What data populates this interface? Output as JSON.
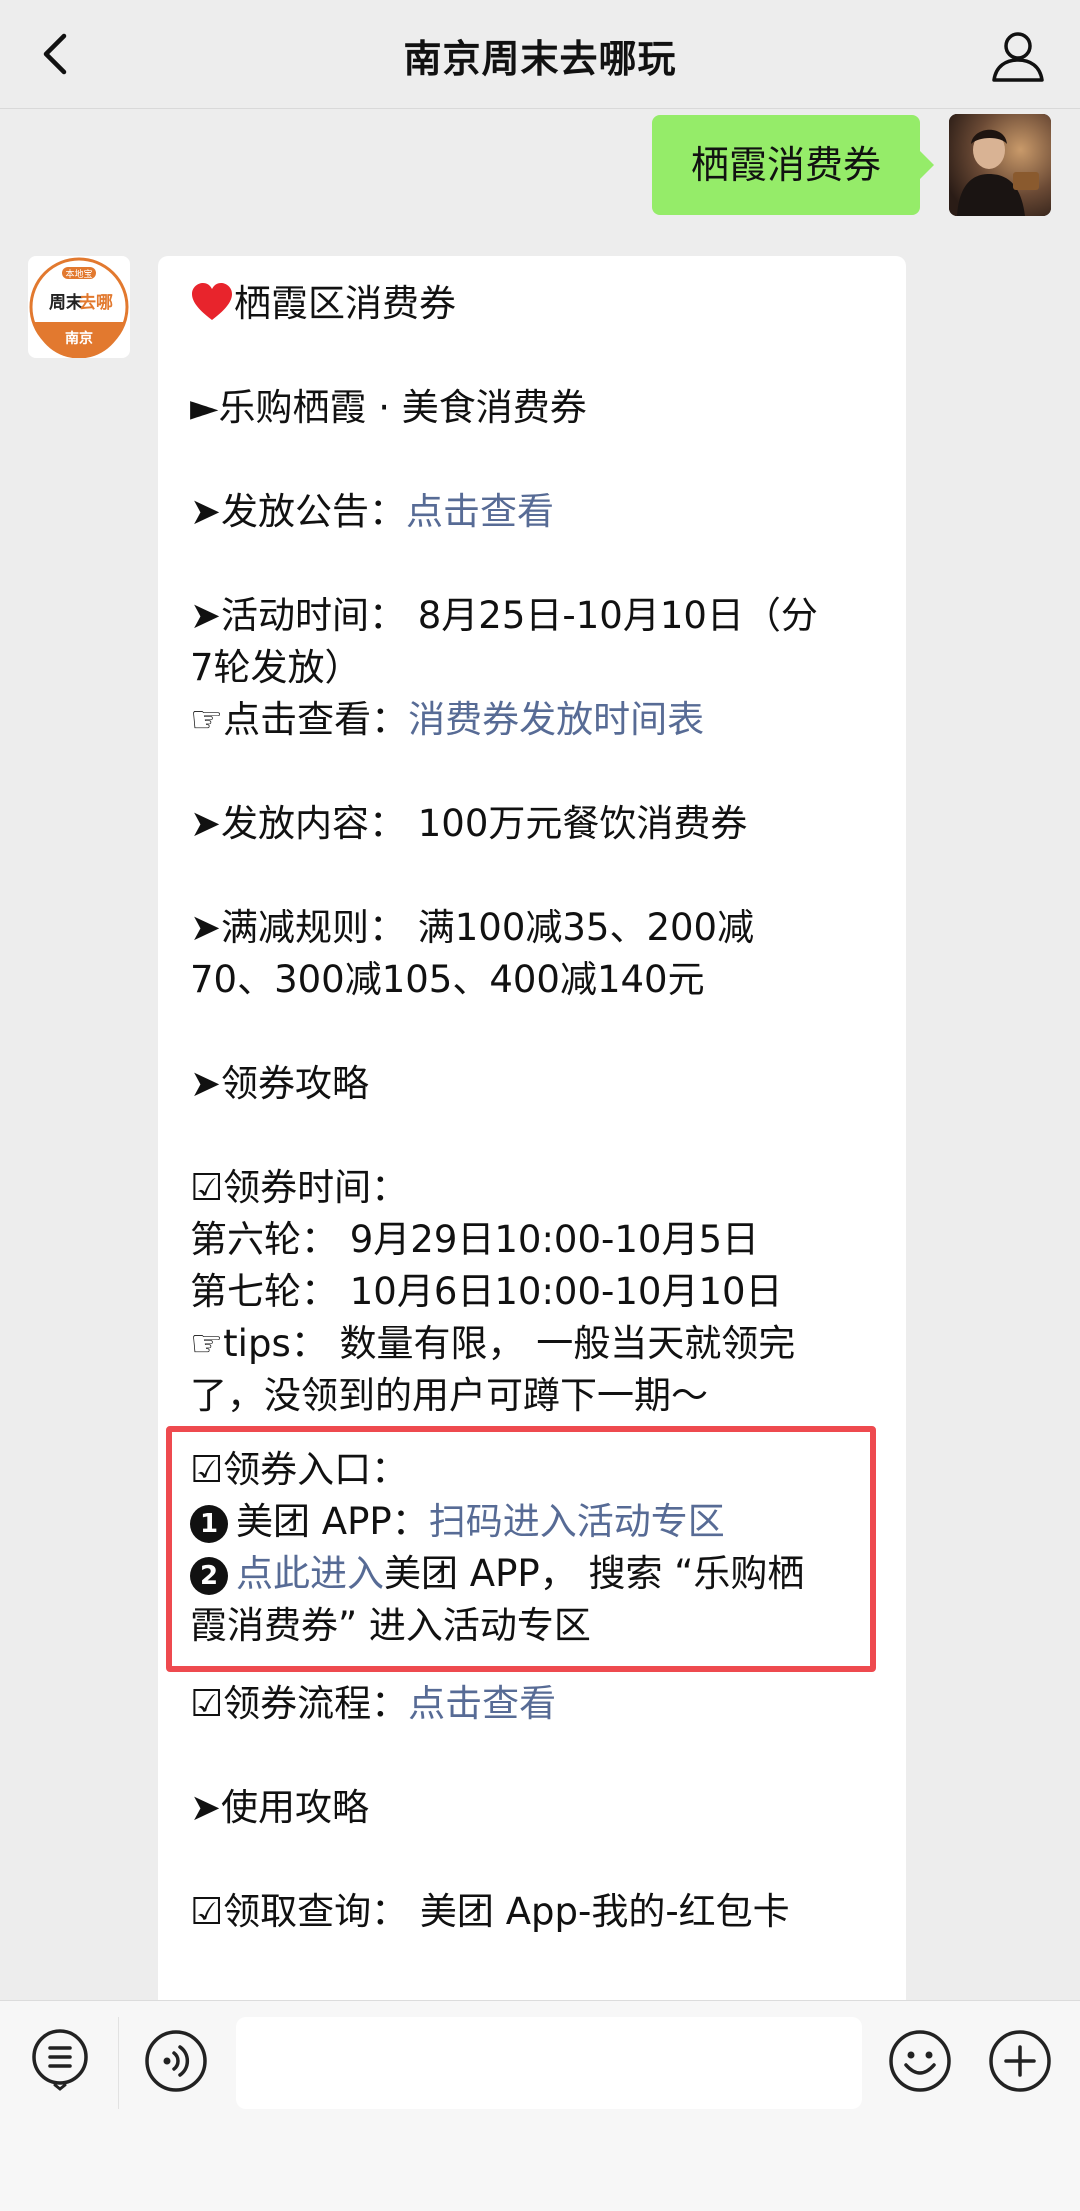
{
  "header": {
    "title": "南京周末去哪玩"
  },
  "sent_message": {
    "text": "栖霞消费券"
  },
  "bot_avatar": {
    "top_text": "本地宝",
    "brand_a": "周末",
    "brand_b": "去哪",
    "bottom_text": "南京"
  },
  "message": {
    "title": "栖霞区消费券",
    "subtitle": "►乐购栖霞 · 美食消费券",
    "announce_label": "➤发放公告：",
    "announce_link": "点击查看",
    "period_line1": "➤活动时间： 8月25日-10月10日（分",
    "period_line2": "7轮发放）",
    "schedule_label": "☞点击查看：",
    "schedule_link": "消费券发放时间表",
    "content": "➤发放内容： 100万元餐饮消费券",
    "rules_line1": "➤满减规则： 满100减35、200减",
    "rules_line2": "70、300减105、400减140元",
    "guide_title": "➤领券攻略",
    "time_title": "☑领券时间：",
    "round6": "第六轮： 9月29日10:00-10月5日",
    "round7": "第七轮： 10月6日10:00-10月10日",
    "tips_line1": "☞tips： 数量有限， 一般当天就领完",
    "tips_line2": "了，没领到的用户可蹲下一期～",
    "entry_title": "☑领券入口：",
    "entry1_num": "1",
    "entry1_text": "美团 APP：",
    "entry1_link": "扫码进入活动专区",
    "entry2_num": "2",
    "entry2_link": "点此进入",
    "entry2_text": "美团 APP， 搜索 “乐购栖",
    "entry2_line2": "霞消费券” 进入活动专区",
    "flow_label": "☑领券流程：",
    "flow_link": "点击查看",
    "use_title": "➤使用攻略",
    "query": "☑领取查询： 美团 App-我的-红包卡"
  },
  "input_bar": {
    "placeholder": ""
  },
  "colors": {
    "link": "#576b95",
    "bubble_me": "#95ec69",
    "highlight_box": "#ee4a4f",
    "heart": "#e8242c"
  }
}
